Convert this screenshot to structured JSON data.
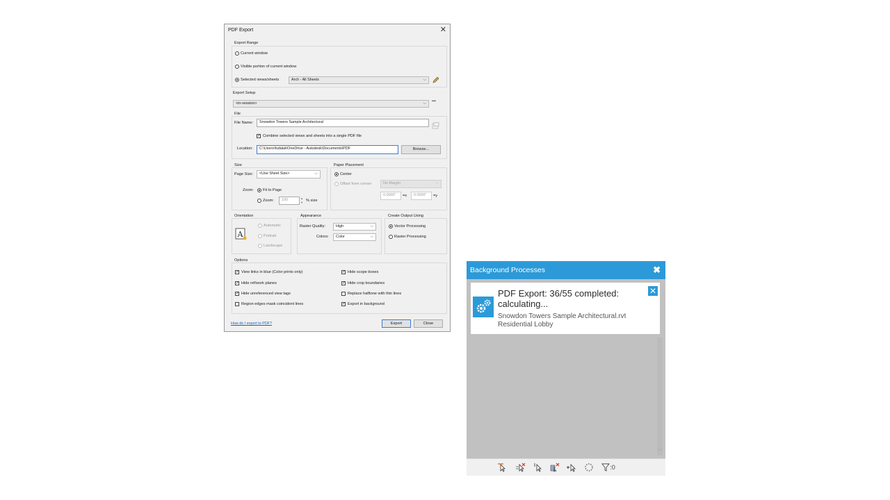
{
  "dialog": {
    "title": "PDF Export",
    "export_range": {
      "label": "Export Range",
      "current_window": "Current window",
      "visible_portion": "Visible portion of current window",
      "selected": "Selected views/sheets",
      "selected_value": "Arch - All Sheets"
    },
    "export_setup": {
      "label": "Export Setup",
      "value": "<in-session>",
      "more": "•••"
    },
    "file": {
      "label": "File",
      "name_label": "File Name:",
      "name_value": "Snowdon Towers Sample Architectural",
      "combine": "Combine selected views and sheets into a single PDF file",
      "location_label": "Location:",
      "location_value": "C:\\Users\\fudalat\\OneDrive - Autodesk\\Documents\\PDF",
      "browse": "Browse..."
    },
    "size": {
      "label": "Size",
      "page_size_label": "Page Size:",
      "page_size_value": "<Use Sheet Size>",
      "zoom_label": "Zoom:",
      "fit": "Fit to Page",
      "zoom_opt": "Zoom:",
      "zoom_value": "100",
      "percent": "% size"
    },
    "placement": {
      "label": "Paper Placement",
      "center": "Center",
      "offset": "Offset from corner:",
      "margin_value": "No Margin",
      "x_value": "0.0000\"",
      "x_label": "=x",
      "y_value": "0.0000\"",
      "y_label": "=y"
    },
    "orientation": {
      "label": "Orientation",
      "automatic": "Automatic",
      "portrait": "Portrait",
      "landscape": "Landscape"
    },
    "appearance": {
      "label": "Appearance",
      "raster_label": "Raster Quality:",
      "raster_value": "High",
      "colors_label": "Colors:",
      "colors_value": "Color"
    },
    "output": {
      "label": "Create Output Using",
      "vector": "Vector Processing",
      "raster": "Raster Processing"
    },
    "options": {
      "label": "Options",
      "left": [
        {
          "label": "View links in blue (Color prints only)",
          "checked": true
        },
        {
          "label": "Hide ref/work planes",
          "checked": true
        },
        {
          "label": "Hide unreferenced view tags",
          "checked": true
        },
        {
          "label": "Region edges mask coincident lines",
          "checked": false
        }
      ],
      "right": [
        {
          "label": "Hide scope boxes",
          "checked": true
        },
        {
          "label": "Hide crop boundaries",
          "checked": true
        },
        {
          "label": "Replace halftone with thin lines",
          "checked": false
        },
        {
          "label": "Export in background",
          "checked": true
        }
      ]
    },
    "help_link": "How do I export to PDF?",
    "export_button": "Export",
    "close_button": "Close"
  },
  "background_processes": {
    "title": "Background Processes",
    "close_icon": "close-icon",
    "accent": "#2c9ad8",
    "task": {
      "status": "PDF Export: 36/55 completed: calculating...",
      "file": "Snowdon Towers Sample Architectural.rvt",
      "view": "Residential Lobby"
    },
    "toolbar": {
      "filter_count": ":0"
    }
  }
}
